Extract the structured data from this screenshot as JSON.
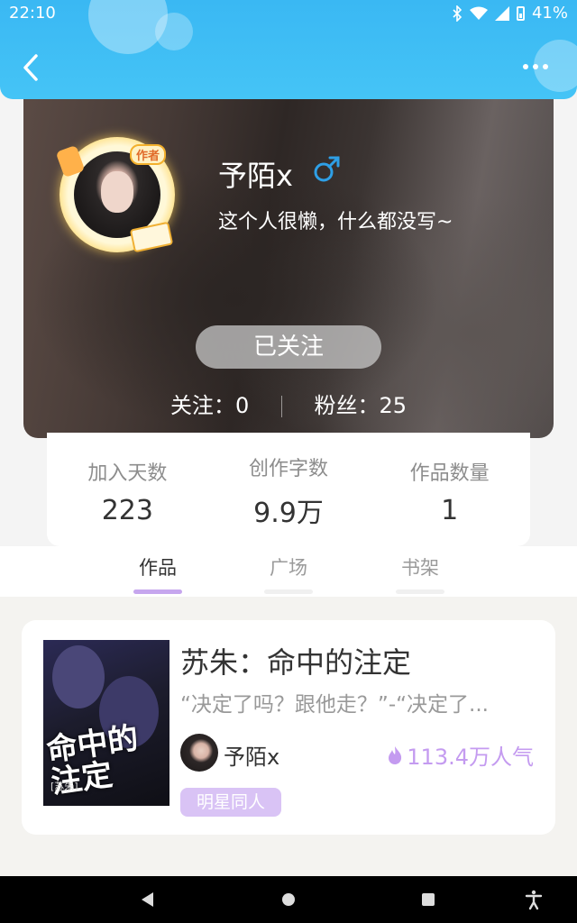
{
  "status_bar": {
    "time": "22:10",
    "battery": "41%"
  },
  "colors": {
    "header": "#3ab8f3",
    "accent_purple": "#c49bf0",
    "male_blue": "#2e9fe6"
  },
  "profile": {
    "name": "予陌x",
    "gender_icon": "male-icon",
    "bio": "这个人很懒，什么都没写~",
    "author_badge": "作者",
    "follow_button": "已关注",
    "following_label": "关注：",
    "following_count": "0",
    "fans_label": "粉丝：",
    "fans_count": "25"
  },
  "stats": [
    {
      "label": "加入天数",
      "value": "223"
    },
    {
      "label": "创作字数",
      "value": "9.9万"
    },
    {
      "label": "作品数量",
      "value": "1"
    }
  ],
  "tabs": [
    {
      "label": "作品",
      "active": true
    },
    {
      "label": "广场",
      "active": false
    },
    {
      "label": "书架",
      "active": false
    }
  ],
  "works": [
    {
      "title": "苏朱：命中的注定",
      "description": "“决定了吗？跟他走？”-“决定了...",
      "cover_text": "命中的注定",
      "cover_sub": "[苏朱]",
      "author": "予陌x",
      "popularity": "113.4万人气",
      "tag": "明星同人"
    }
  ]
}
